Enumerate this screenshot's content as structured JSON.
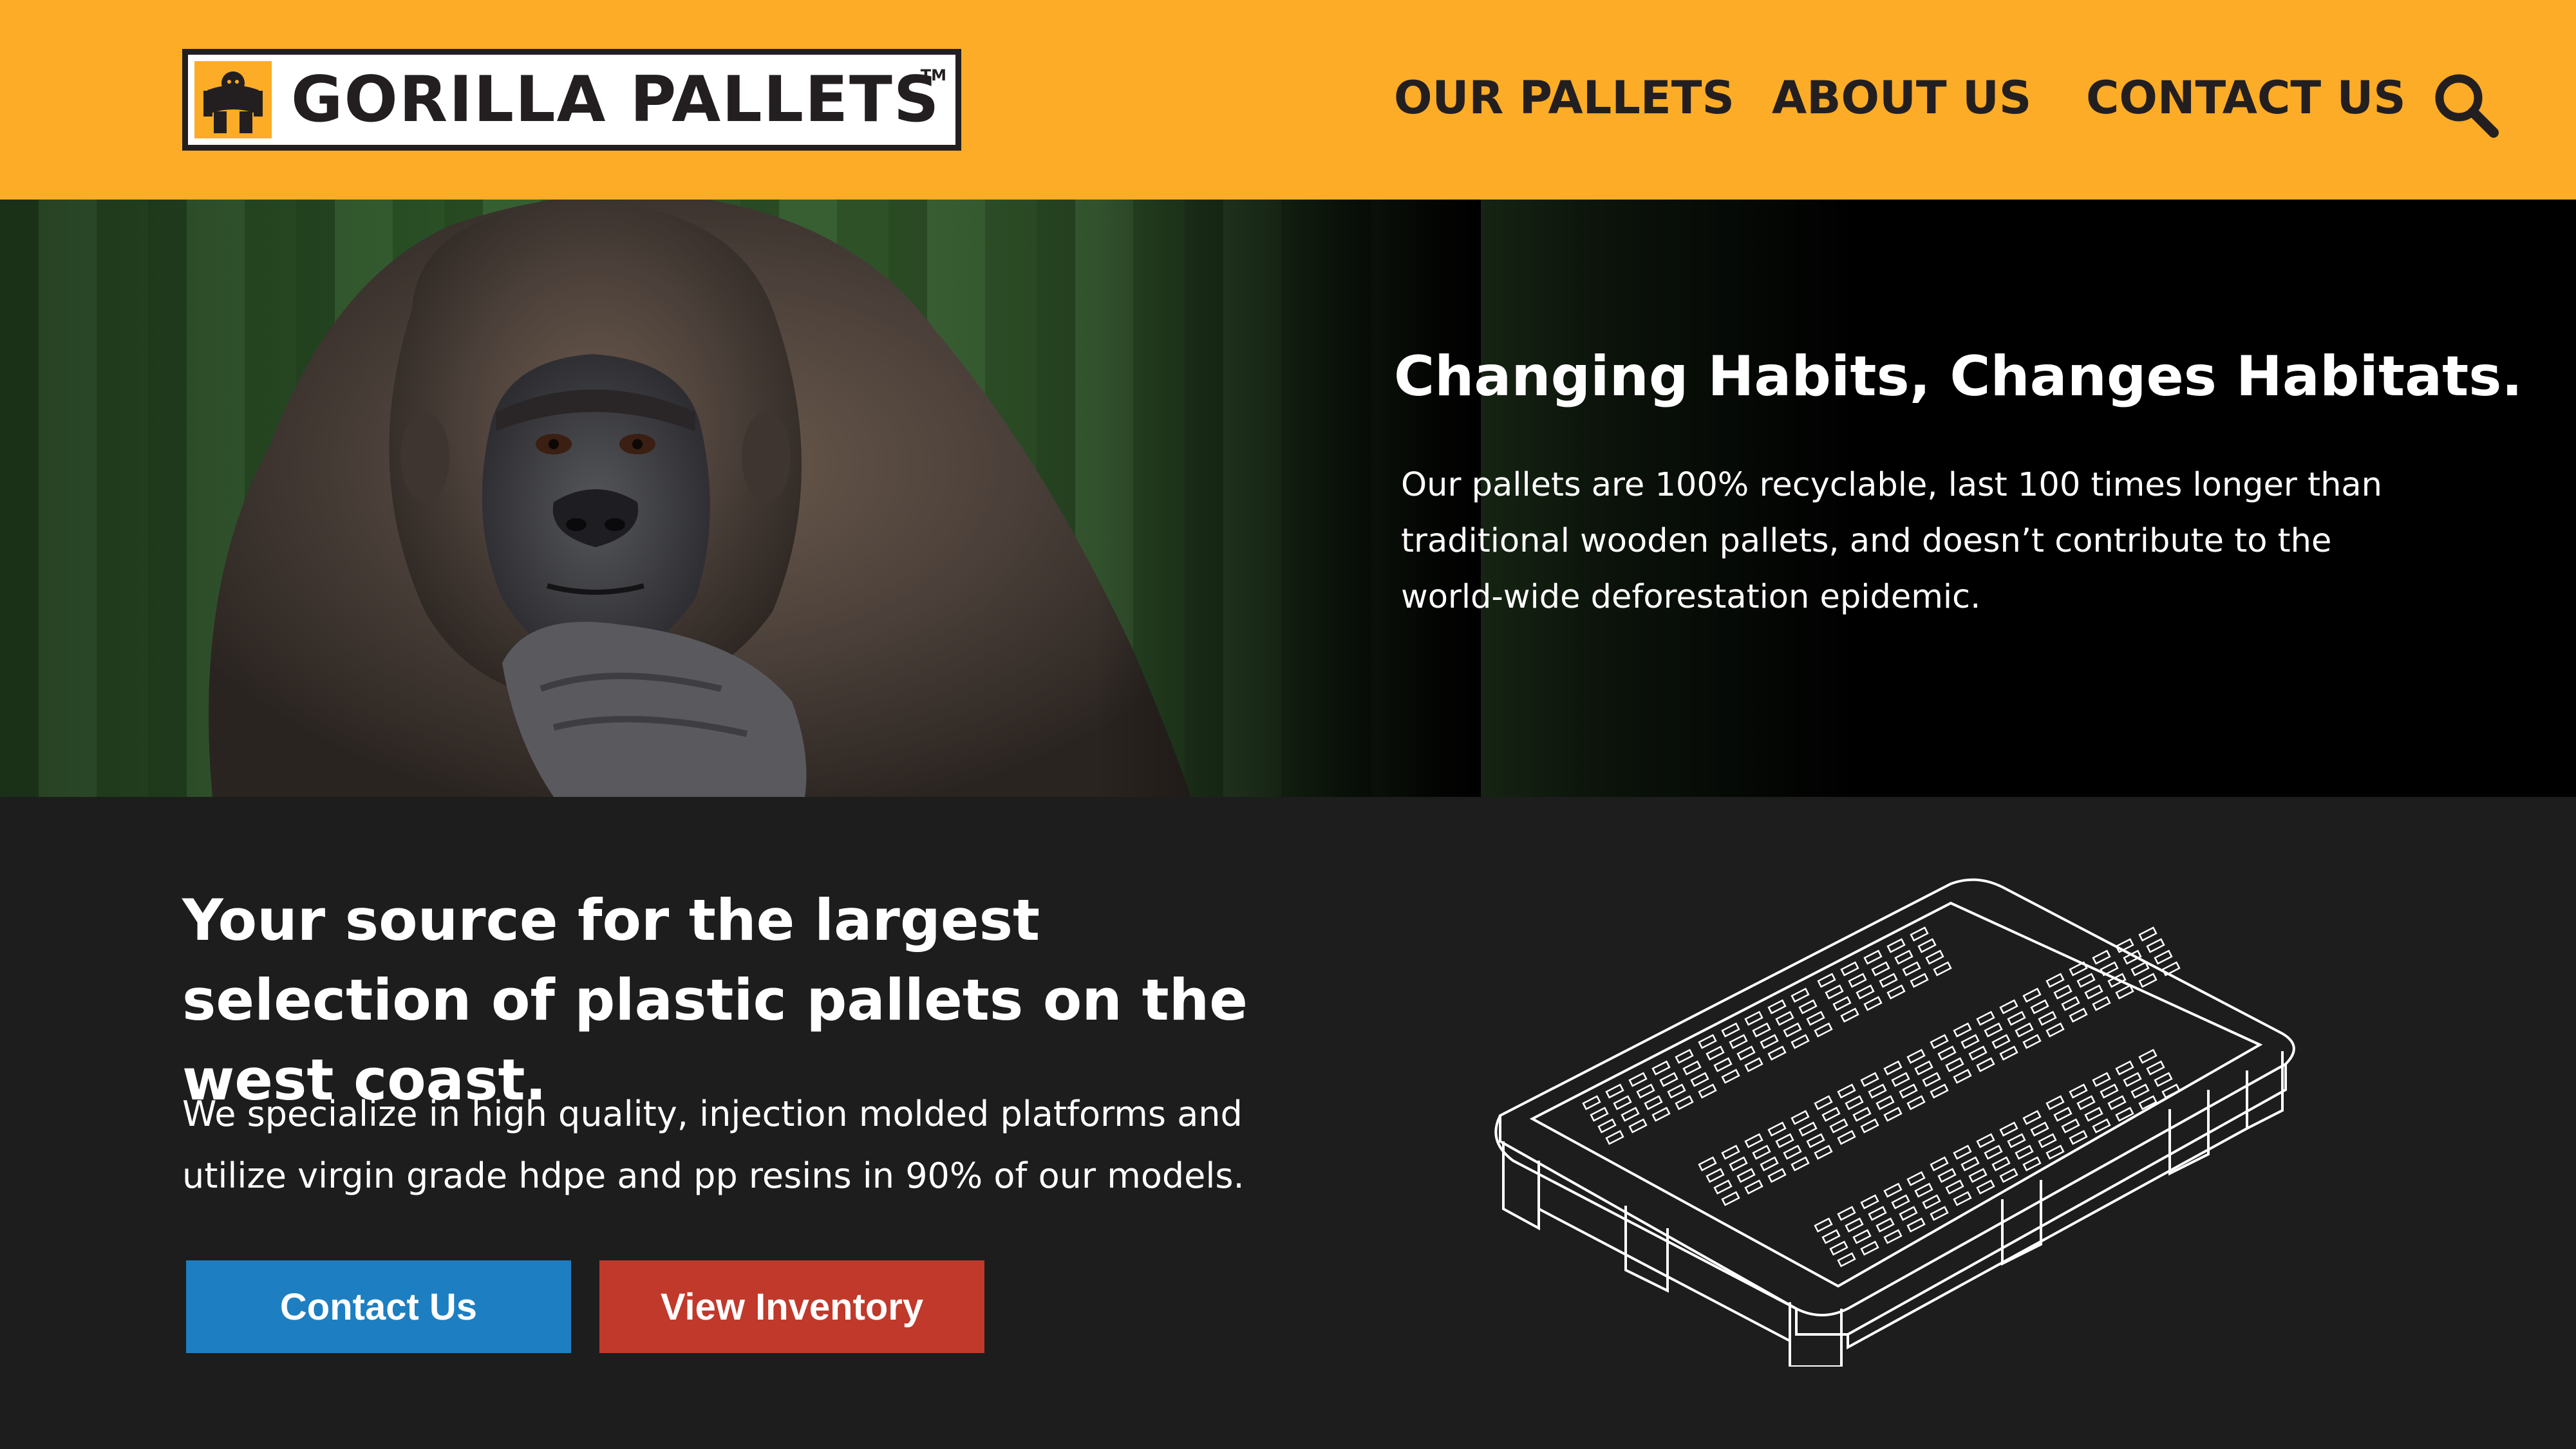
{
  "header": {
    "logo_text": "GORILLA PALLETS",
    "logo_tm": "TM",
    "nav": [
      "OUR PALLETS",
      "ABOUT US",
      "CONTACT US"
    ],
    "search_icon": "search-icon"
  },
  "hero": {
    "title": "Changing Habits, Changes Habitats.",
    "body": "Our pallets are 100% recyclable, last 100 times longer than traditional wooden pallets, and doesn’t contribute to the world-wide deforestation epidemic."
  },
  "lower": {
    "title": "Your source for the largest selection of plastic pallets on the west coast.",
    "body": "We specialize in high quality, injection molded platforms and utilize virgin grade hdpe and pp resins in 90% of our models.",
    "buttons": {
      "contact": "Contact Us",
      "inventory": "View Inventory"
    }
  },
  "colors": {
    "header_bg": "#fcac26",
    "contact_button": "#1d7fc2",
    "inventory_button": "#c0392b",
    "dark_bg": "#1d1d1d"
  }
}
